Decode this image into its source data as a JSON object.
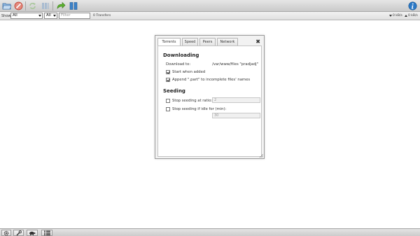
{
  "toolbar": {
    "buttons": [
      {
        "name": "open-torrent",
        "icon": "folder-open-icon"
      },
      {
        "name": "remove-torrent",
        "icon": "cancel-circle-icon"
      },
      {
        "name": "start-selected",
        "icon": "refresh-arrows-icon"
      },
      {
        "name": "pause-selected",
        "icon": "pause-bars-icon"
      },
      {
        "name": "start-all",
        "icon": "green-arrow-icon"
      },
      {
        "name": "pause-all",
        "icon": "pause-blue-icon"
      },
      {
        "name": "inspector",
        "icon": "info-icon"
      }
    ]
  },
  "filterbar": {
    "show_label": "Show",
    "state_filter": "All",
    "tracker_filter": "All",
    "filter_placeholder": "Filter",
    "transfers": "0 Transfers",
    "download_speed": "0 kB/s",
    "upload_speed": "0 kB/s"
  },
  "dialog": {
    "tabs": [
      "Torrents",
      "Speed",
      "Peers",
      "Network"
    ],
    "active_tab": "Torrents",
    "close": "✖",
    "downloading": {
      "title": "Downloading",
      "download_to_label": "Download to:",
      "download_to_value": "/var/www/files \"pradjadj\"",
      "start_when_added": "Start when added",
      "append_part": "Append \".part\" to incomplete files' names"
    },
    "seeding": {
      "title": "Seeding",
      "stop_ratio_label": "Stop seeding at ratio:",
      "stop_ratio_value": "2",
      "stop_idle_label": "Stop seeding if idle for (min):",
      "stop_idle_value": "30"
    }
  },
  "colors": {
    "toolbar_bg": "#d4d4d4",
    "accent_blue": "#2a78c5",
    "cancel_red": "#d43a2a",
    "start_green": "#55a829"
  },
  "bottombar": {
    "buttons": [
      "gear-icon",
      "wrench-icon",
      "turtle-icon",
      "list-icon"
    ]
  }
}
